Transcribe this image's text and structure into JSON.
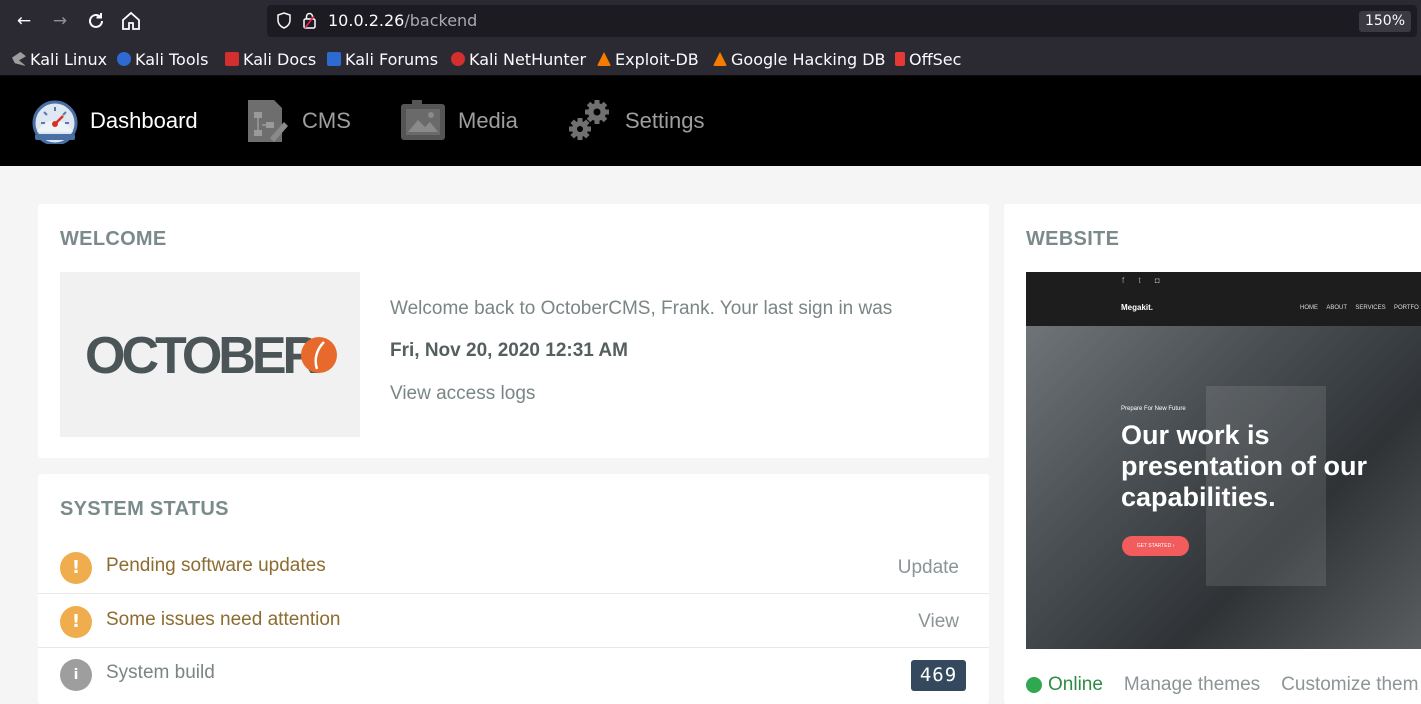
{
  "browser": {
    "url_host": "10.0.2.26",
    "url_path": "/backend",
    "zoom": "150%"
  },
  "bookmarks": [
    {
      "label": "Kali Linux",
      "color": "#9e9e9e"
    },
    {
      "label": "Kali Tools",
      "color": "#2d6ad1"
    },
    {
      "label": "Kali Docs",
      "color": "#d32f2f"
    },
    {
      "label": "Kali Forums",
      "color": "#2d6ad1"
    },
    {
      "label": "Kali NetHunter",
      "color": "#d32f2f"
    },
    {
      "label": "Exploit-DB",
      "color": "#f57c00"
    },
    {
      "label": "Google Hacking DB",
      "color": "#f57c00"
    },
    {
      "label": "OffSec",
      "color": "#e53935"
    }
  ],
  "nav": {
    "dashboard": "Dashboard",
    "cms": "CMS",
    "media": "Media",
    "settings": "Settings"
  },
  "welcome": {
    "title": "WELCOME",
    "logo_text": "OCTOBER",
    "message": "Welcome back to OctoberCMS, Frank. Your last sign in was",
    "last_signin": "Fri, Nov 20, 2020 12:31 AM",
    "access_logs": "View access logs"
  },
  "system_status": {
    "title": "SYSTEM STATUS",
    "rows": [
      {
        "label": "Pending software updates",
        "action": "Update",
        "icon": "exclamation-icon"
      },
      {
        "label": "Some issues need attention",
        "action": "View",
        "icon": "exclamation-icon"
      },
      {
        "label": "System build",
        "badge": "469",
        "icon": "info-icon"
      }
    ]
  },
  "website": {
    "title": "WEBSITE",
    "preview": {
      "brand": "Megakit.",
      "menu": [
        "HOME",
        "ABOUT",
        "SERVICES",
        "PORTFO"
      ],
      "tagline": "Prepare For New Future",
      "headline_1": "Our work is",
      "headline_2": "presentation of our",
      "headline_3": "capabilities.",
      "cta": "GET STARTED"
    },
    "status": "Online",
    "manage_themes": "Manage themes",
    "customize": "Customize them"
  },
  "colors": {
    "warning": "#f0ad4e",
    "info": "#9e9e9e",
    "warning_text": "#8d6c2f",
    "online": "#2fa84f",
    "badge": "#34495e",
    "accent": "#e8692c"
  }
}
